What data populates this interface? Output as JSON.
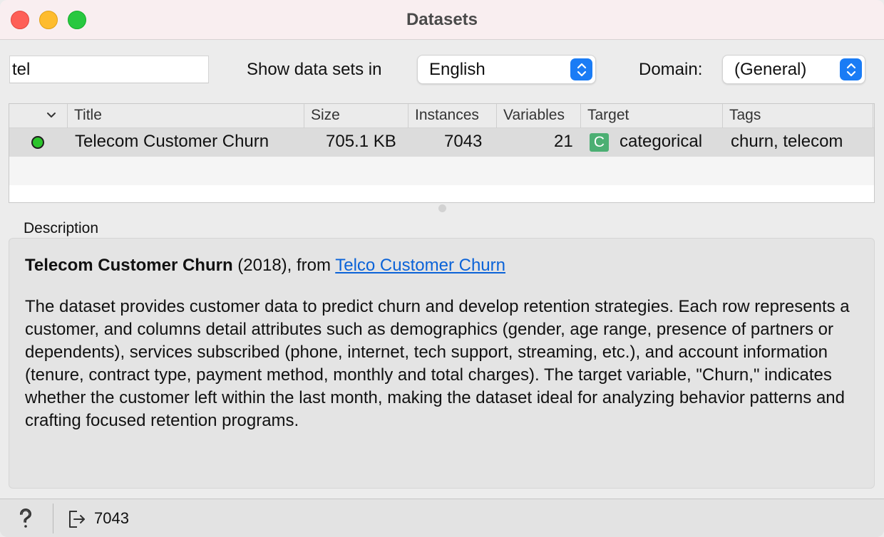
{
  "window": {
    "title": "Datasets"
  },
  "filter": {
    "search_value": "tel",
    "show_label": "Show data sets in",
    "language": "English",
    "domain_label": "Domain:",
    "domain": "(General)"
  },
  "table": {
    "columns": [
      "Title",
      "Size",
      "Instances",
      "Variables",
      "Target",
      "Tags"
    ],
    "rows": [
      {
        "status": "downloaded",
        "title": "Telecom Customer Churn",
        "size": "705.1 KB",
        "instances": "7043",
        "variables": "21",
        "target_badge": "C",
        "target": "categorical",
        "tags": "churn, telecom"
      }
    ]
  },
  "description": {
    "label": "Description",
    "title": "Telecom Customer Churn",
    "year_from": " (2018), from ",
    "source_link": "Telco Customer Churn",
    "body": "The dataset provides customer data to predict churn and develop retention strategies. Each row represents a customer, and columns detail attributes such as demographics (gender, age range, presence of partners or dependents), services subscribed (phone, internet, tech support, streaming, etc.), and account information (tenure, contract type, payment method, monthly and total charges). The target variable, \"Churn,\" indicates whether the customer left within the last month, making the dataset ideal for analyzing behavior patterns and crafting focused retention programs."
  },
  "status": {
    "output_count": "7043"
  },
  "colors": {
    "accent": "#1a7cf5",
    "link": "#0b63d8",
    "status_dot": "#2bc42b",
    "badge": "#4caf73"
  }
}
